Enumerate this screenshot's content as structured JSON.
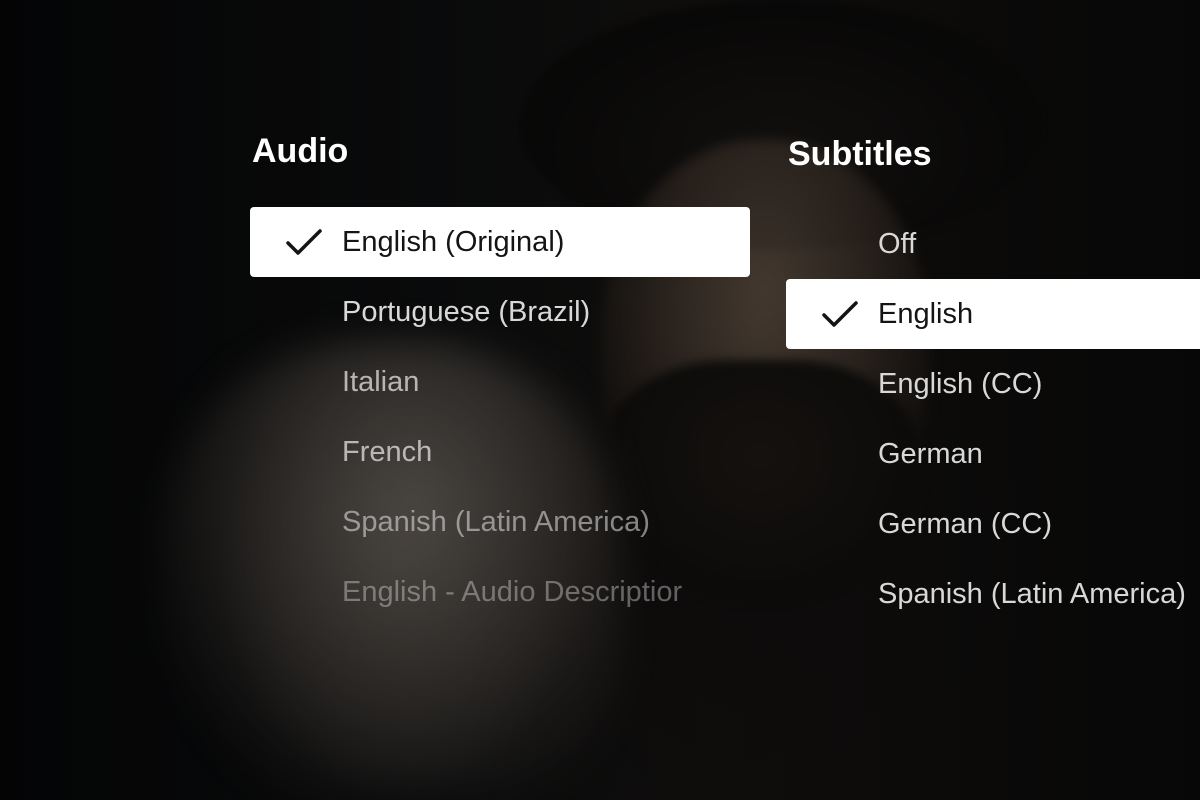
{
  "audio": {
    "title": "Audio",
    "options": [
      {
        "label": "English (Original)",
        "selected": true
      },
      {
        "label": "Portuguese (Brazil)",
        "selected": false
      },
      {
        "label": "Italian",
        "selected": false
      },
      {
        "label": "French",
        "selected": false
      },
      {
        "label": "Spanish (Latin America)",
        "selected": false
      },
      {
        "label": "English - Audio Descriptior",
        "selected": false
      }
    ]
  },
  "subtitles": {
    "title": "Subtitles",
    "options": [
      {
        "label": "Off",
        "selected": false
      },
      {
        "label": "English",
        "selected": true
      },
      {
        "label": "English (CC)",
        "selected": false
      },
      {
        "label": "German",
        "selected": false
      },
      {
        "label": "German (CC)",
        "selected": false
      },
      {
        "label": "Spanish (Latin America)",
        "selected": false
      }
    ]
  },
  "icons": {
    "selected_marker": "checkmark-icon"
  },
  "colors": {
    "selected_bg": "#ffffff",
    "selected_text": "#141414",
    "text": "#d8d8d8"
  }
}
